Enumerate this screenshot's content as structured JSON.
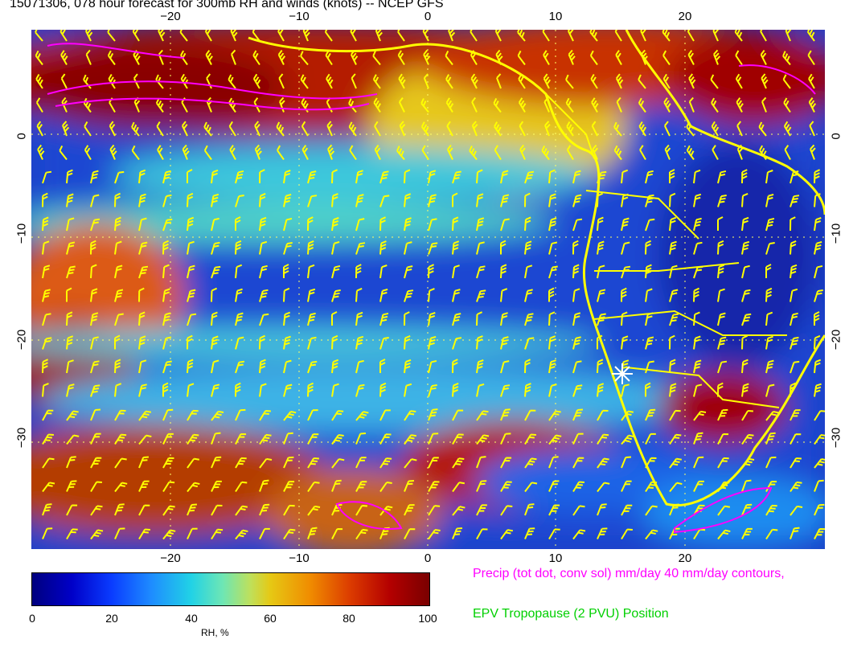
{
  "title": "15071306, 078 hour forecast for 300mb RH and winds (knots) -- NCEP GFS",
  "axes": {
    "lon_ticks": [
      "−20",
      "−10",
      "0",
      "10",
      "20"
    ],
    "lat_ticks": [
      "0",
      "−10",
      "−20",
      "−30"
    ]
  },
  "colorbar": {
    "label": "RH, %",
    "ticks": [
      "0",
      "20",
      "40",
      "60",
      "80",
      "100"
    ],
    "range": [
      0,
      100
    ]
  },
  "legend": {
    "precip": "Precip (tot dot, conv sol) mm/day 40 mm/day contours,",
    "epv": "EPV Tropopause (2 PVU) Position"
  },
  "colors": {
    "coastline": "#ffff00",
    "wind_barbs": "#ffff00",
    "precip_contour": "#ff00ff",
    "epv_text": "#00d000",
    "marker": "#ffffff"
  }
}
